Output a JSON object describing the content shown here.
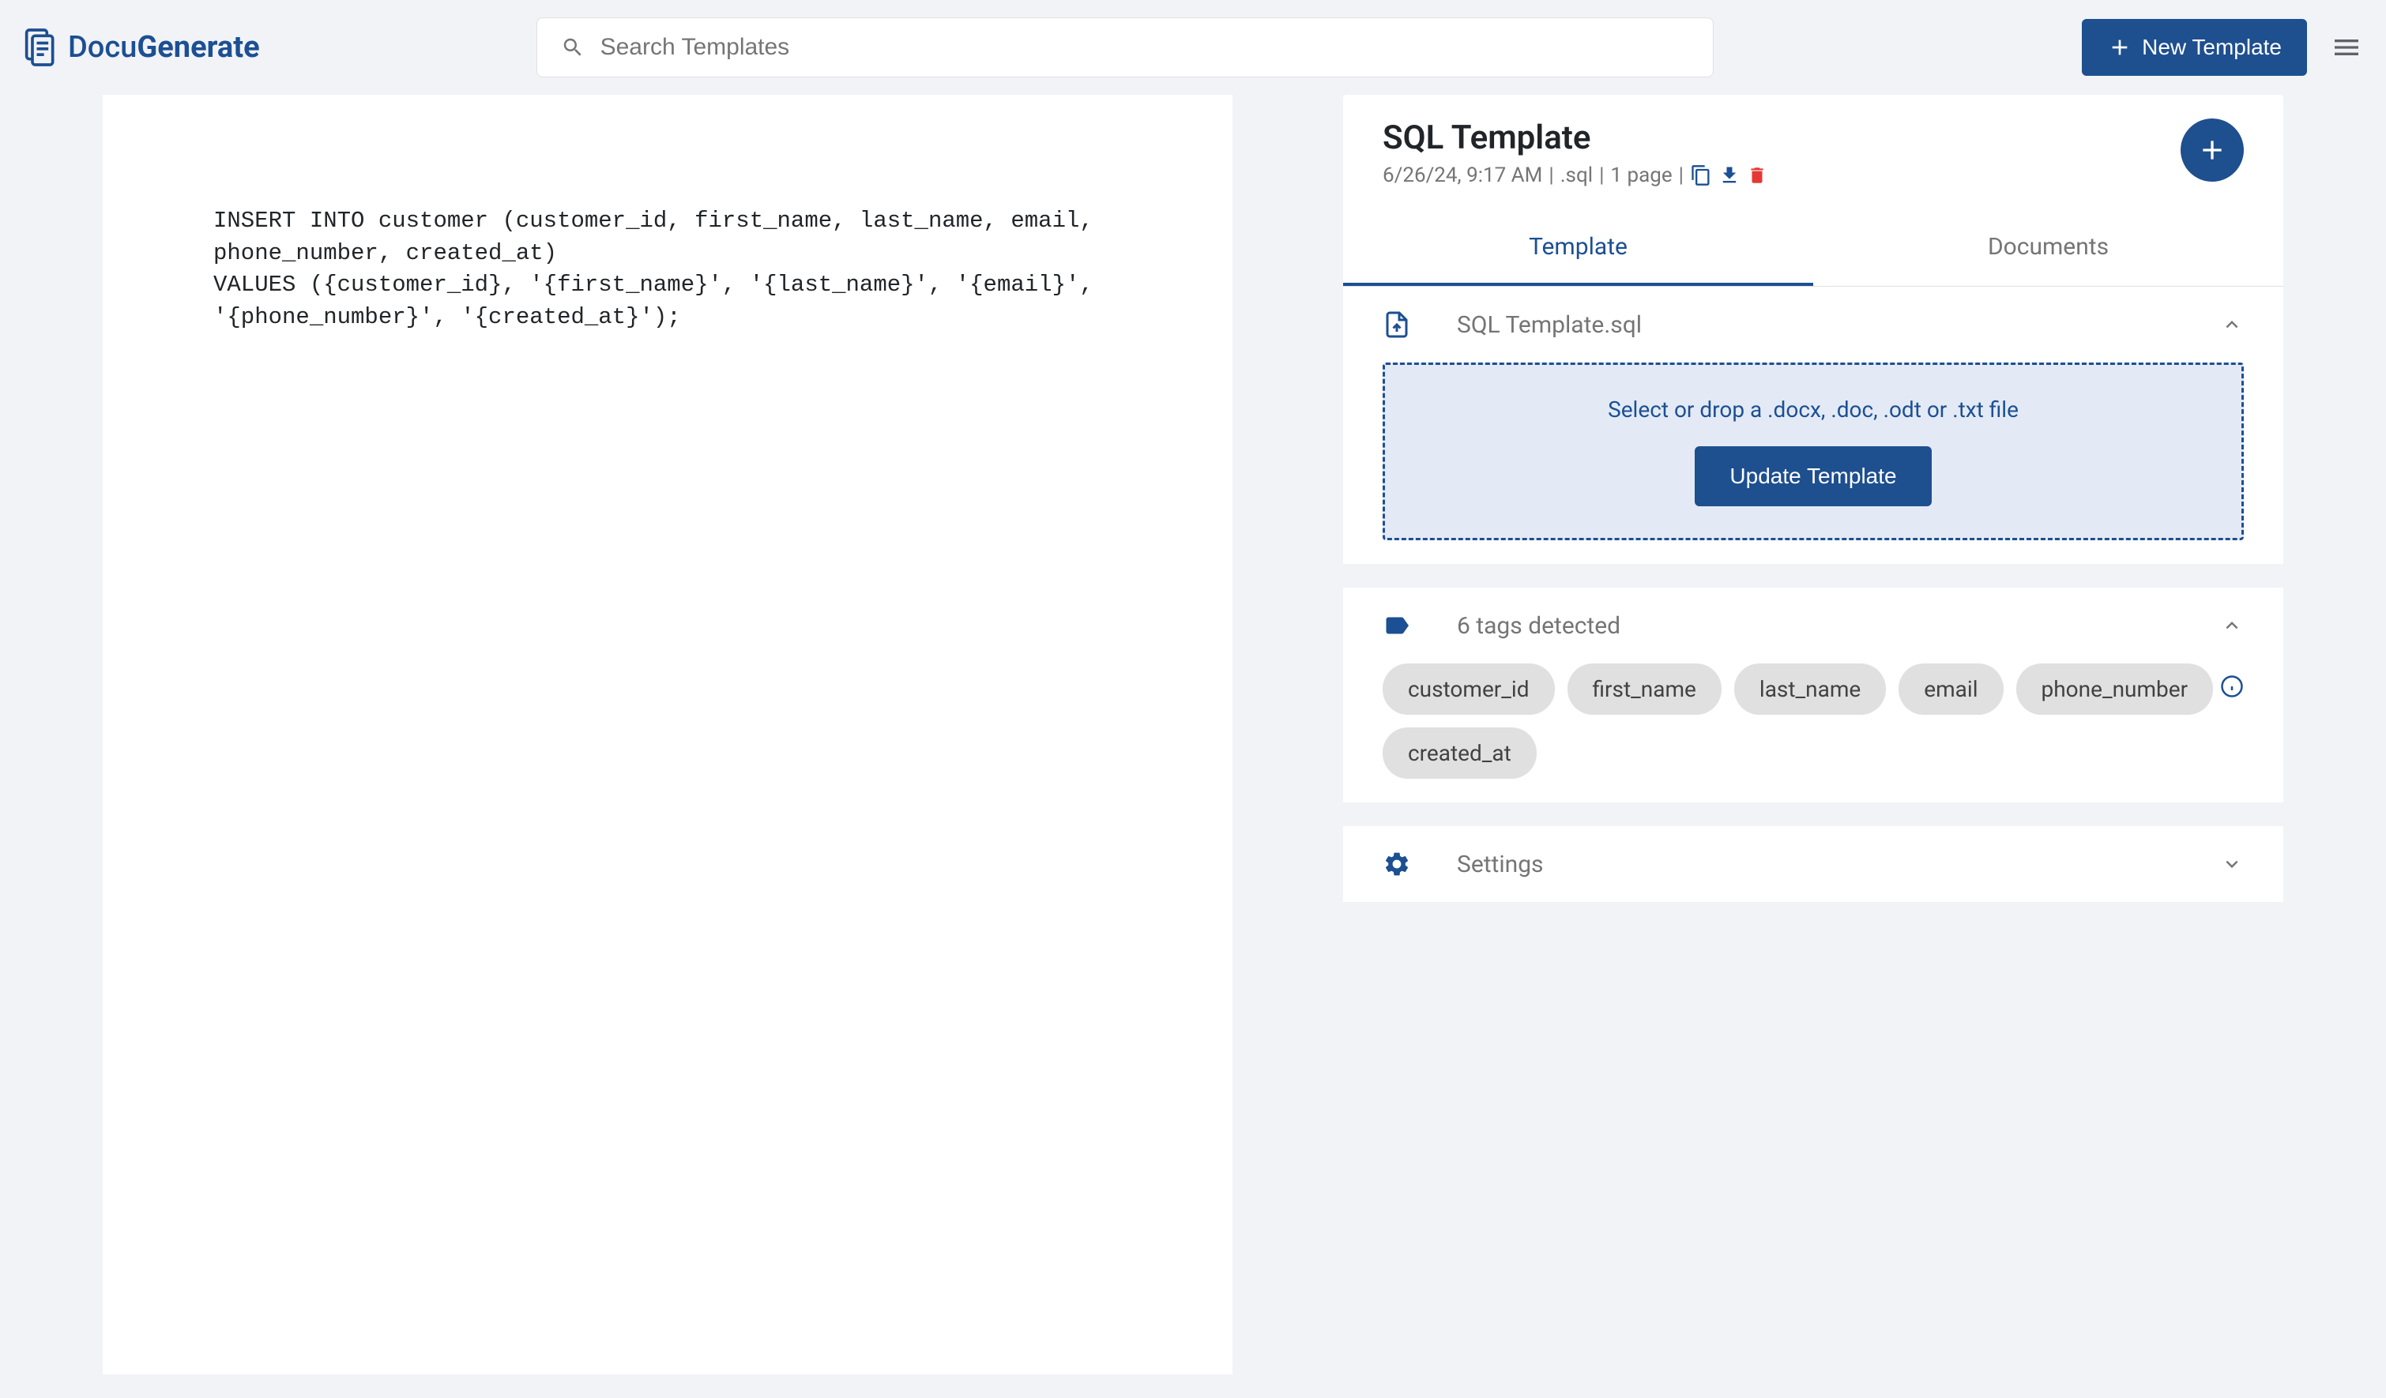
{
  "header": {
    "logo_prefix": "Docu",
    "logo_suffix": "Generate",
    "search_placeholder": "Search Templates",
    "new_template_label": "New Template"
  },
  "template": {
    "title": "SQL Template",
    "date": "6/26/24, 9:17 AM",
    "extension": ".sql",
    "pages": "1 page",
    "sep": " | ",
    "code": "INSERT INTO customer (customer_id, first_name, last_name, email, phone_number, created_at)\nVALUES ({customer_id}, '{first_name}', '{last_name}', '{email}', '{phone_number}', '{created_at}');"
  },
  "tabs": {
    "template": "Template",
    "documents": "Documents"
  },
  "file_section": {
    "filename": "SQL Template.sql",
    "dropzone_text": "Select or drop a .docx, .doc, .odt or .txt file",
    "update_button": "Update Template"
  },
  "tags_section": {
    "title": "6 tags detected",
    "tags": [
      "customer_id",
      "first_name",
      "last_name",
      "email",
      "phone_number",
      "created_at"
    ]
  },
  "settings_section": {
    "title": "Settings"
  }
}
